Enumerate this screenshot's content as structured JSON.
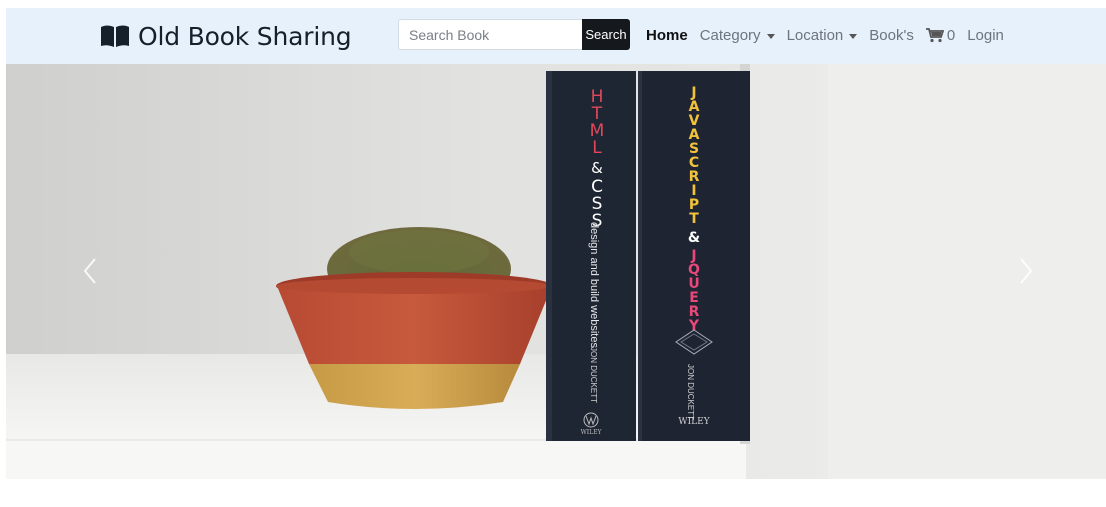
{
  "brand": {
    "name": "Old Book Sharing",
    "icon": "open-book-icon"
  },
  "search": {
    "placeholder": "Search Book",
    "button_label": "Search"
  },
  "nav": {
    "home": "Home",
    "category": "Category",
    "location": "Location",
    "books": "Book's",
    "cart_count": "0",
    "login": "Login"
  },
  "carousel": {
    "book1_title_top": "HTML",
    "book1_amp": "&",
    "book1_title_bottom": "CSS",
    "book1_subtitle": "design and build websites",
    "book1_author": "JON DUCKETT",
    "book1_publisher": "WILEY",
    "book2_title_top": "JAVASCRIPT",
    "book2_amp": "&",
    "book2_title_bottom": "JQUERY",
    "book2_author": "JON DUCKETT",
    "book2_publisher": "WILEY"
  },
  "colors": {
    "navbar_bg": "#e6f1fc",
    "search_button": "#15181c",
    "book_spine": "#1f2633"
  }
}
